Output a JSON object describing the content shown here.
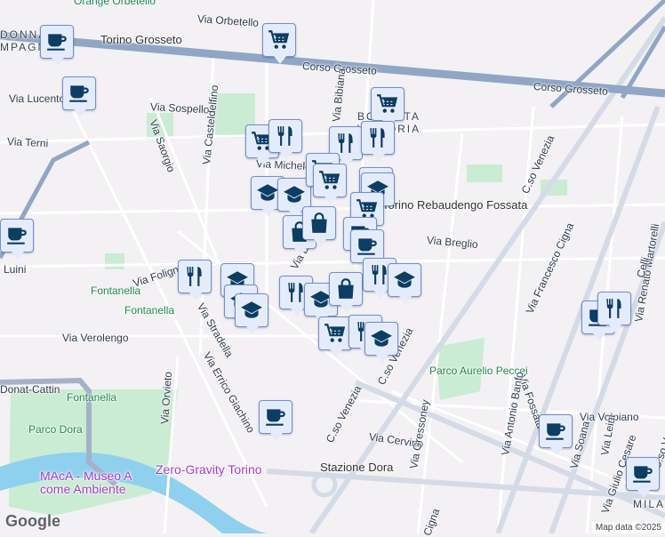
{
  "labels": {
    "orange_orbetello": "Orange Orbetello",
    "via_orbetello": "Via Orbetello",
    "torino_grosseto": "Torino Grosseto",
    "corso_grosseto_1": "Corso Grosseto",
    "corso_grosseto_2": "Corso Grosseto",
    "donna_campagna_1": "DONNA",
    "donna_campagna_2": "MPAGNA",
    "via_lucento": "Via Lucento",
    "via_sospello": "Via Sospello",
    "via_saorgio": "Via Saorgio",
    "via_casteldelfino": "Via Casteldelfino",
    "via_terni": "Via Terni",
    "via_bibiana": "Via Bibiana",
    "borgata_vittoria_1": "BORGATA",
    "borgata_vittoria_2": "VITTORIA",
    "via_michele": "Via Michele",
    "torino_rebaudengo": "Torino Rebaudengo Fossata",
    "via_breglio": "Via Breglio",
    "cso_venezia_1": "C.so Venezia",
    "cso_venezia_2": "C.so Venezia",
    "cso_venezia_3": "C.so Venezia",
    "via_luini": "Luini",
    "via_foligno": "Via Foligno",
    "fontanella_1": "Fontanella",
    "fontanella_2": "Fontanella",
    "fontanella_3": "Fontanella",
    "via_stradella": "Via Stradella",
    "via_verolengo": "Via Verolengo",
    "via_errico_giachino": "Via Errico Giachino",
    "via_bibiana_2": "Via Bibiana",
    "donat_cattin": "Donat-Cattin",
    "via_orvieto": "Via Orvieto",
    "parco_dora": "Parco Dora",
    "parco_peccei": "Parco Aurelio Peccei",
    "via_francesco_cigna": "Via Francesco Cigna",
    "via_fossata": "Via Fossata",
    "via_antonio_banfo": "Via Antonio Banfo",
    "via_volpiano": "Via Volpiano",
    "via_cervino": "Via Cervino",
    "via_gressoney": "Via Gressoney",
    "via_soana": "Via Soana",
    "via_leini": "Via Leinì",
    "via_renato_martorelli": "Via Renato Martorelli",
    "zero_gravity": "Zero-Gravity Torino",
    "stazione_dora": "Stazione Dora",
    "macа": "MAcA - Museo A come Ambiente",
    "via_giulio_cesare": "Via Giulio Cesare",
    "milano": "MILAN",
    "celli": "Celli",
    "cigna": "Cigna",
    "cso_v": "C.so V"
  },
  "markers": [
    "coffee-cup",
    "shopping-cart",
    "coffee-cup",
    "shopping-cart",
    "shopping-cart",
    "restaurant",
    "restaurant",
    "restaurant",
    "school",
    "school",
    "shopping-cart",
    "shopping-cart",
    "restaurant",
    "school",
    "shopping-cart",
    "shopping-bag",
    "shopping-bag",
    "coffee-cup",
    "coffee-cup",
    "coffee-cup",
    "restaurant",
    "school",
    "school",
    "school",
    "restaurant",
    "school",
    "shopping-bag",
    "restaurant",
    "school",
    "shopping-cart",
    "restaurant",
    "school",
    "coffee-cup",
    "restaurant",
    "coffee-cup",
    "coffee-cup",
    "coffee-cup"
  ],
  "footer": {
    "logo": "Google",
    "attribution": "Map data ©2025"
  },
  "colors": {
    "marker_bg": "#e4ecfb",
    "marker_border": "#6f8fd1",
    "icon": "#0c3d63",
    "park": "#c9ecd3",
    "river": "#8fd0ef",
    "highway": "#8fa6c5"
  }
}
